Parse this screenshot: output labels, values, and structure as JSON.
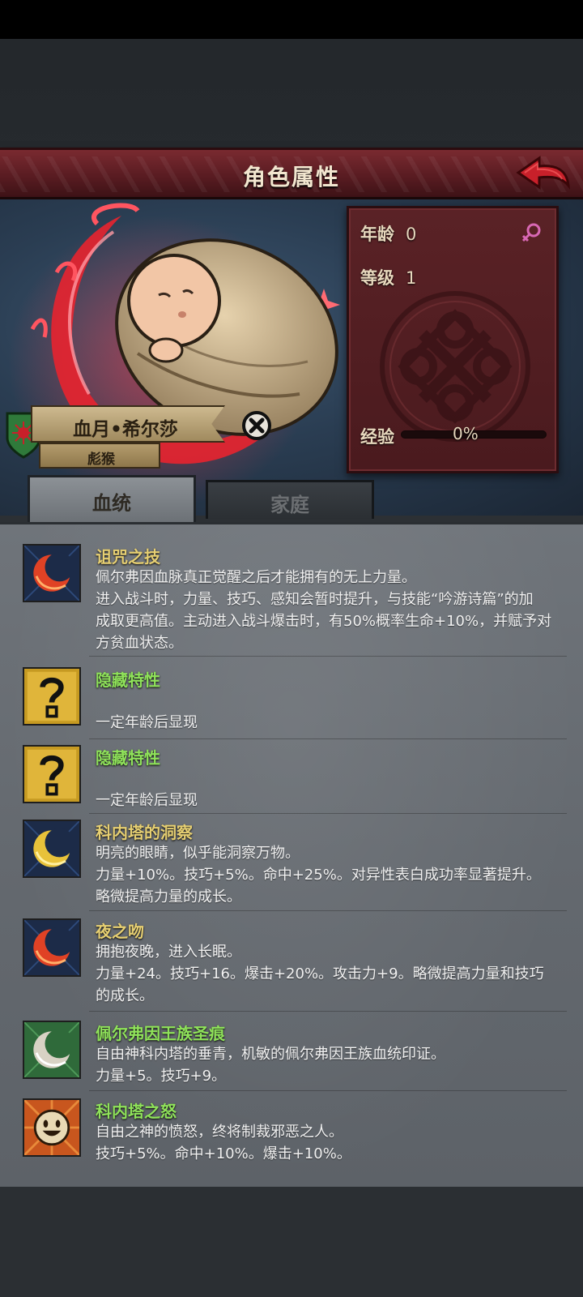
{
  "header": {
    "title": "角色属性"
  },
  "stats": {
    "age_label": "年龄",
    "age_value": "0",
    "level_label": "等级",
    "level_value": "1",
    "exp_label": "经验",
    "exp_text": "0%",
    "exp_fraction": 0,
    "gender_icon": "female-icon"
  },
  "character": {
    "name": "血月•希尔莎",
    "title": "彪猴"
  },
  "tabs": [
    {
      "label": "血统"
    },
    {
      "label": "家庭"
    }
  ],
  "traits": [
    {
      "name": "诅咒之技",
      "name_color": "gold",
      "icon": "red-moon-icon",
      "lines": [
        "佩尔弗因血脉真正觉醒之后才能拥有的无上力量。",
        "进入战斗时，力量、技巧、感知会暂时提升，与技能“吟游诗篇”的加",
        "成取更高值。主动进入战斗爆击时，有50%概率生命+10%，并赋予对",
        "方贫血状态。"
      ]
    },
    {
      "name": "隐藏特性",
      "name_color": "green",
      "icon": "question-mark-icon",
      "lines": [
        "",
        "一定年龄后显现"
      ]
    },
    {
      "name": "隐藏特性",
      "name_color": "green",
      "icon": "question-mark-icon",
      "lines": [
        "",
        "一定年龄后显现"
      ]
    },
    {
      "name": "科内塔的洞察",
      "name_color": "gold",
      "icon": "gold-moon-icon",
      "lines": [
        "明亮的眼睛，似乎能洞察万物。",
        "力量+10%。技巧+5%。命中+25%。对异性表白成功率显著提升。",
        "略微提高力量的成长。"
      ]
    },
    {
      "name": "夜之吻",
      "name_color": "gold",
      "icon": "red-moon-icon",
      "lines": [
        "拥抱夜晚，进入长眠。",
        "力量+24。技巧+16。爆击+20%。攻击力+9。略微提高力量和技巧",
        "的成长。"
      ]
    },
    {
      "name": "佩尔弗因王族圣痕",
      "name_color": "green",
      "icon": "white-moon-icon",
      "lines": [
        "自由神科内塔的垂青，机敏的佩尔弗因王族血统印证。",
        "力量+5。技巧+9。"
      ]
    },
    {
      "name": "科内塔之怒",
      "name_color": "green",
      "icon": "smiley-sun-icon",
      "lines": [
        "自由之神的愤怒，终将制裁邪恶之人。",
        "技巧+5%。命中+10%。爆击+10%。"
      ]
    }
  ]
}
